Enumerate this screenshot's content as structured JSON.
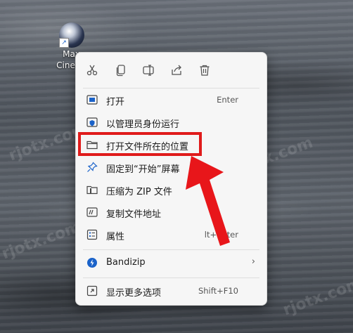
{
  "desktop_icon": {
    "label_line1": "Maxo",
    "label_line2": "Cinema"
  },
  "toolbar": {
    "buttons": [
      {
        "name": "cut",
        "icon": "scissors-icon"
      },
      {
        "name": "copy",
        "icon": "copy-icon"
      },
      {
        "name": "rename",
        "icon": "rename-icon"
      },
      {
        "name": "share",
        "icon": "share-icon"
      },
      {
        "name": "delete",
        "icon": "trash-icon"
      }
    ]
  },
  "menu": {
    "items": [
      {
        "label": "打开",
        "shortcut": "Enter",
        "icon": "open-icon"
      },
      {
        "label": "以管理员身份运行",
        "shortcut": "",
        "icon": "shield-icon"
      },
      {
        "label": "打开文件所在的位置",
        "shortcut": "",
        "icon": "folder-icon"
      },
      {
        "label": "固定到“开始”屏幕",
        "shortcut": "",
        "icon": "pin-icon"
      },
      {
        "label": "压缩为 ZIP 文件",
        "shortcut": "",
        "icon": "zip-icon"
      },
      {
        "label": "复制文件地址",
        "shortcut": "",
        "icon": "path-icon"
      },
      {
        "label": "属性",
        "shortcut": "lt+Enter",
        "icon": "properties-icon"
      },
      {
        "label": "Bandizip",
        "shortcut": "",
        "icon": "bandizip-icon"
      },
      {
        "label": "显示更多选项",
        "shortcut": "Shift+F10",
        "icon": "more-options-icon"
      }
    ]
  },
  "watermark": "rjotx.com",
  "colors": {
    "highlight": "#e01b1b",
    "accent": "#1a62c9"
  }
}
